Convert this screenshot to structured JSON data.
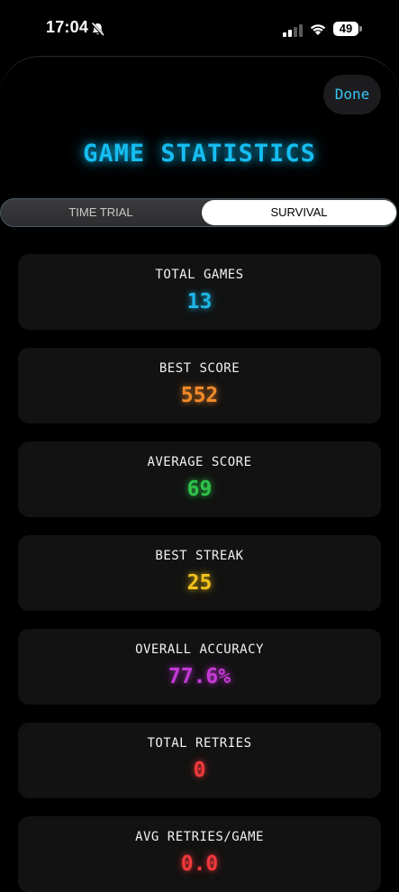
{
  "status_bar": {
    "time": "17:04",
    "battery": "49"
  },
  "header": {
    "done_label": "Done",
    "title": "GAME STATISTICS"
  },
  "tabs": [
    {
      "label": "TIME TRIAL",
      "selected": false
    },
    {
      "label": "SURVIVAL",
      "selected": true
    }
  ],
  "stats": [
    {
      "label": "TOTAL GAMES",
      "value": "13",
      "color": "#1fb6e6"
    },
    {
      "label": "BEST SCORE",
      "value": "552",
      "color": "#f08a2a"
    },
    {
      "label": "AVERAGE SCORE",
      "value": "69",
      "color": "#2fc24a"
    },
    {
      "label": "BEST STREAK",
      "value": "25",
      "color": "#f2c21c"
    },
    {
      "label": "OVERALL ACCURACY",
      "value": "77.6%",
      "color": "#c43ad6"
    },
    {
      "label": "TOTAL RETRIES",
      "value": "0",
      "color": "#f0393c"
    },
    {
      "label": "AVG RETRIES/GAME",
      "value": "0.0",
      "color": "#f0393c"
    }
  ],
  "icons": {
    "bell": "bell-slash-icon",
    "signal": "cellular-signal-icon",
    "wifi": "wifi-icon",
    "battery": "battery-icon"
  }
}
